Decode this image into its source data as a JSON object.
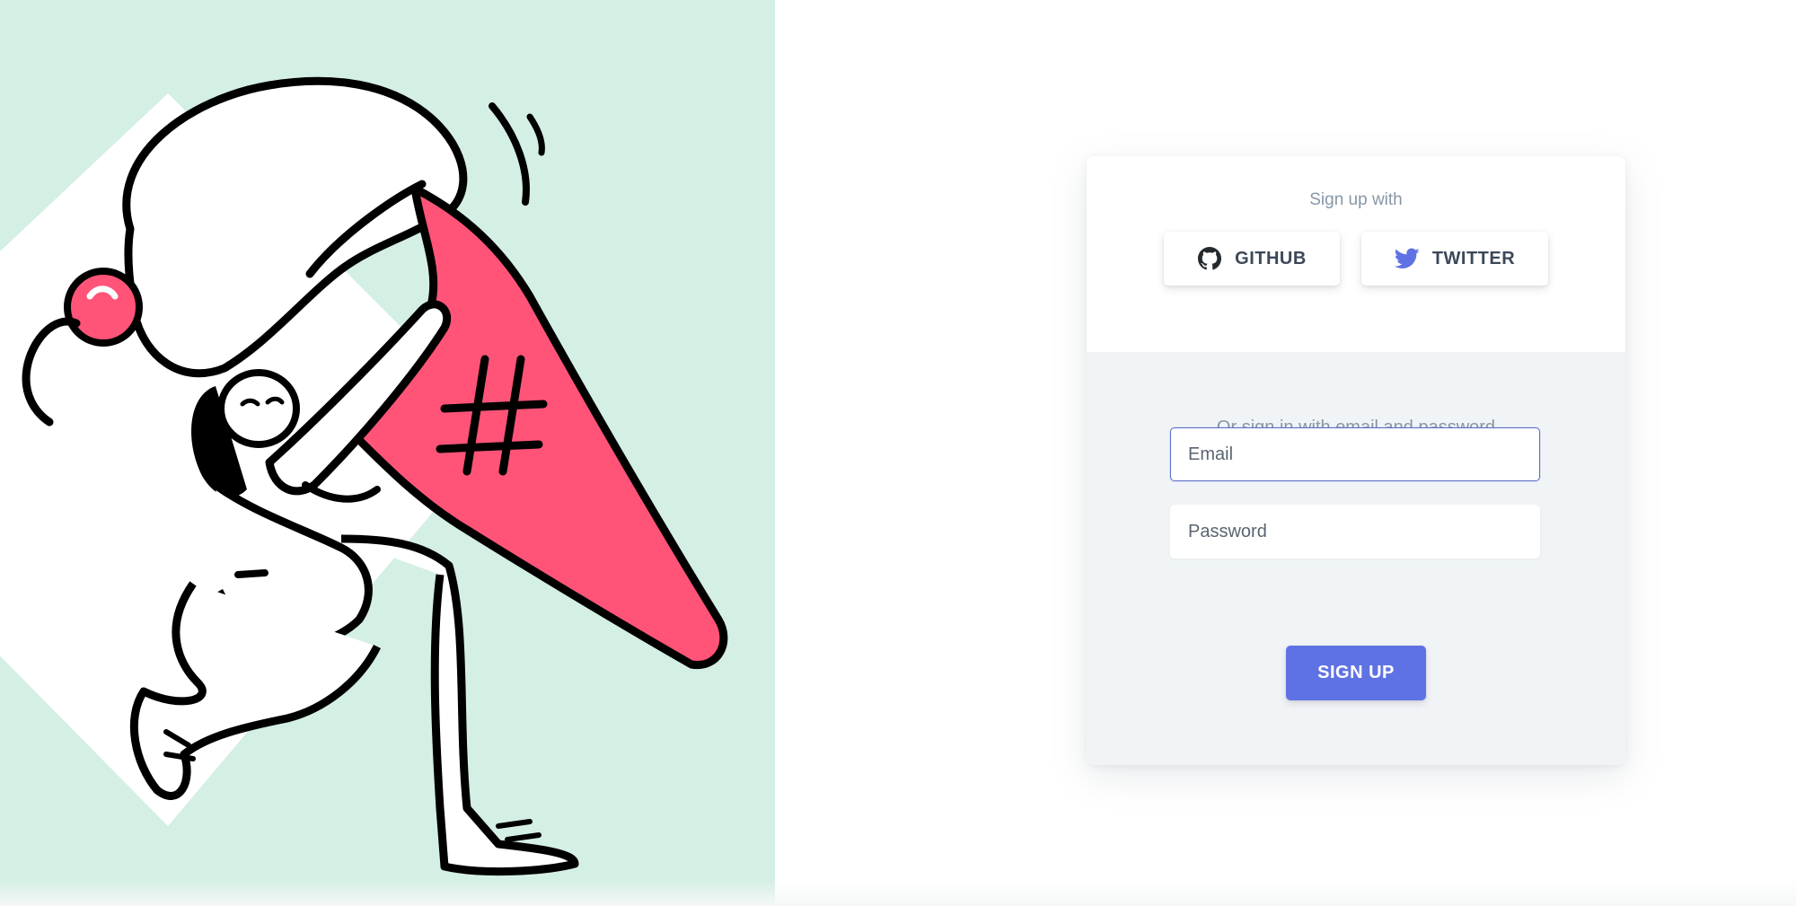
{
  "social": {
    "title": "Sign up with",
    "github_label": "GITHUB",
    "twitter_label": "TWITTER",
    "github_icon": "github-icon",
    "twitter_icon": "twitter-icon",
    "twitter_color": "#5f72e4"
  },
  "form": {
    "title": "Or sign in with email and password",
    "email_placeholder": "Email",
    "password_placeholder": "Password",
    "submit_label": "SIGN UP",
    "accent_color": "#5f72e4"
  },
  "illustration": {
    "background_color": "#d4efe3",
    "accent_color": "#ff5478"
  }
}
